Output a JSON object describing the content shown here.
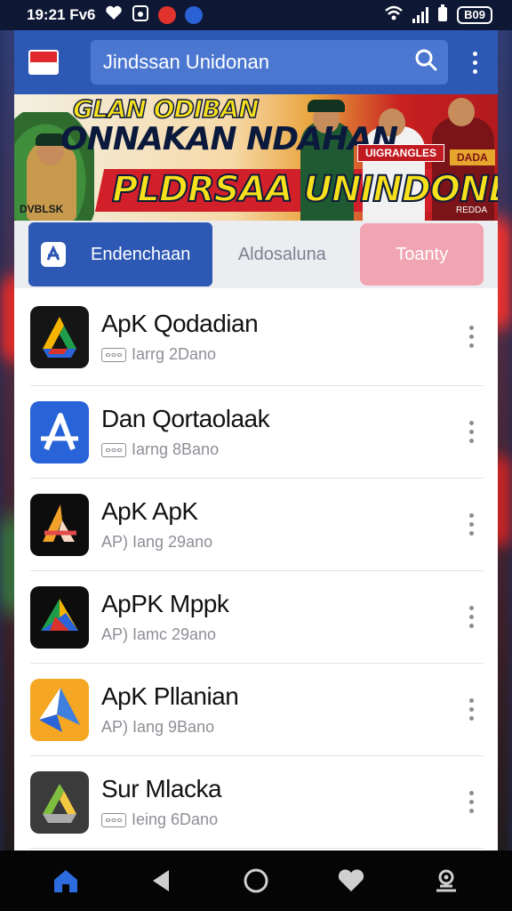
{
  "status_bar": {
    "time": "19:21 Fv6",
    "battery": "B09"
  },
  "header": {
    "search_value": "Jindssan Unidonan"
  },
  "banner": {
    "line1": "GLAN ODIBAN",
    "line2": "ONNAKAN NDAHAN",
    "line3": "PLDRSAA UNINDONESIA",
    "badge": "UIGRANGLES",
    "badge2": "DADA",
    "watermark": "DVBLSK",
    "small_tag": "REDDA"
  },
  "tabs": [
    {
      "label": "Endenchaan",
      "icon": "app-store-icon",
      "state": "active"
    },
    {
      "label": "Aldosaluna",
      "state": "inactive"
    },
    {
      "label": "Toanty",
      "state": "highlight"
    }
  ],
  "apps": [
    {
      "title": "ApK Qodadian",
      "box": "ⴰⴰⴰ",
      "subtitle": "Iarrg 2Dano",
      "icon": "google-drive-icon"
    },
    {
      "title": "Dan Qortaolaak",
      "box": "ⴰⴰⴰ",
      "subtitle": "Iarng 8Bano",
      "icon": "app-store-a-icon"
    },
    {
      "title": "ApK ApK",
      "box": "",
      "subtitle": "AP) Iang 29ano",
      "icon": "apk-a-icon"
    },
    {
      "title": "ApPK Mppk",
      "box": "",
      "subtitle": "AP) Iamc 29ano",
      "icon": "play-triangle-icon"
    },
    {
      "title": "ApK Pllanian",
      "box": "",
      "subtitle": "AP) Iang 9Bano",
      "icon": "paper-plane-icon"
    },
    {
      "title": "Sur Mlacka",
      "box": "ⴰⴰⴰ",
      "subtitle": "Ieing 6Dano",
      "icon": "drive-triangle-icon"
    }
  ],
  "colors": {
    "primary": "#2d58b3",
    "search_bg": "#4b77d1",
    "tab_pink": "#f1a5b2",
    "nav_home_active": "#2d6cdf"
  },
  "bottom_nav": {
    "items": [
      "home-icon",
      "back-icon",
      "circle-home-icon",
      "heart-icon",
      "account-icon"
    ]
  }
}
